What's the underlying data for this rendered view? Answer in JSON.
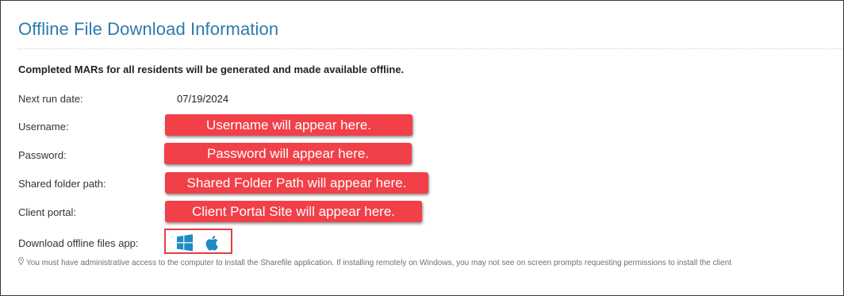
{
  "panel": {
    "title": "Offline File Download Information",
    "intro": "Completed MARs for all residents will be generated and made available offline."
  },
  "rows": {
    "next_run": {
      "label": "Next run date:",
      "value": "07/19/2024"
    },
    "username": {
      "label": "Username:",
      "value": "Username will appear here."
    },
    "password": {
      "label": "Password:",
      "value": "Password will appear here."
    },
    "shared_folder": {
      "label": "Shared folder path:",
      "value": "Shared Folder Path will appear here."
    },
    "client_portal": {
      "label": "Client portal:",
      "value": "Client Portal Site will appear here."
    },
    "download_app": {
      "label": "Download offline files app:"
    }
  },
  "apps": {
    "windows_icon": "windows-icon",
    "apple_icon": "apple-icon",
    "icon_color": "#1e8bc3"
  },
  "note": {
    "icon": "map-pin-icon",
    "text": "You must have administrative access to the computer to install the Sharefile application. If installing remotely on Windows, you may not see on screen prompts requesting permissions to install the client"
  },
  "colors": {
    "title": "#2a7bab",
    "callout_bg": "#f14048",
    "highlight_border": "#e63c45"
  }
}
